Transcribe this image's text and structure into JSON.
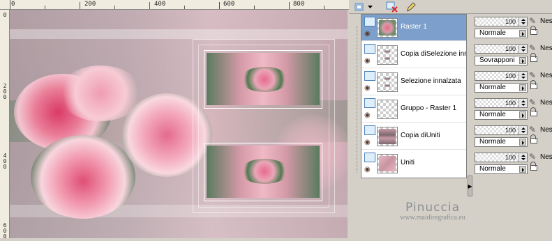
{
  "ruler": {
    "top_labels": [
      "0",
      "200",
      "400",
      "600",
      "800"
    ],
    "left_labels": [
      "0",
      "200",
      "400",
      "600"
    ]
  },
  "toolbar": {
    "icons": [
      "new-layer-icon",
      "dropdown-arrow-icon",
      "delete-layer-icon",
      "edit-pencil-icon"
    ]
  },
  "layers": [
    {
      "name": "Raster 1",
      "selected": true
    },
    {
      "name": "Copia diSelezione innalzata",
      "selected": false
    },
    {
      "name": "Selezione innalzata",
      "selected": false
    },
    {
      "name": "Gruppo - Raster 1",
      "selected": false
    },
    {
      "name": "Copia diUniti",
      "selected": false
    },
    {
      "name": "Uniti",
      "selected": false
    }
  ],
  "layer_props": [
    {
      "opacity": "100",
      "blend": "Normale",
      "mask": "Nes"
    },
    {
      "opacity": "100",
      "blend": "Sovrapponi",
      "mask": "Nes"
    },
    {
      "opacity": "100",
      "blend": "Normale",
      "mask": "Nes"
    },
    {
      "opacity": "100",
      "blend": "Normale",
      "mask": "Nes"
    },
    {
      "opacity": "100",
      "blend": "Normale",
      "mask": "Nes"
    },
    {
      "opacity": "100",
      "blend": "Normale",
      "mask": "Nes"
    }
  ],
  "watermark": {
    "name": "Pinuccia",
    "url": "www.maidiregrafica.eu"
  },
  "colors": {
    "selected_row": "#7d9fcb",
    "panel_bg": "#d4d0c8",
    "canvas_pink": "#e9a7b8",
    "canvas_green": "#5a7a5e"
  }
}
